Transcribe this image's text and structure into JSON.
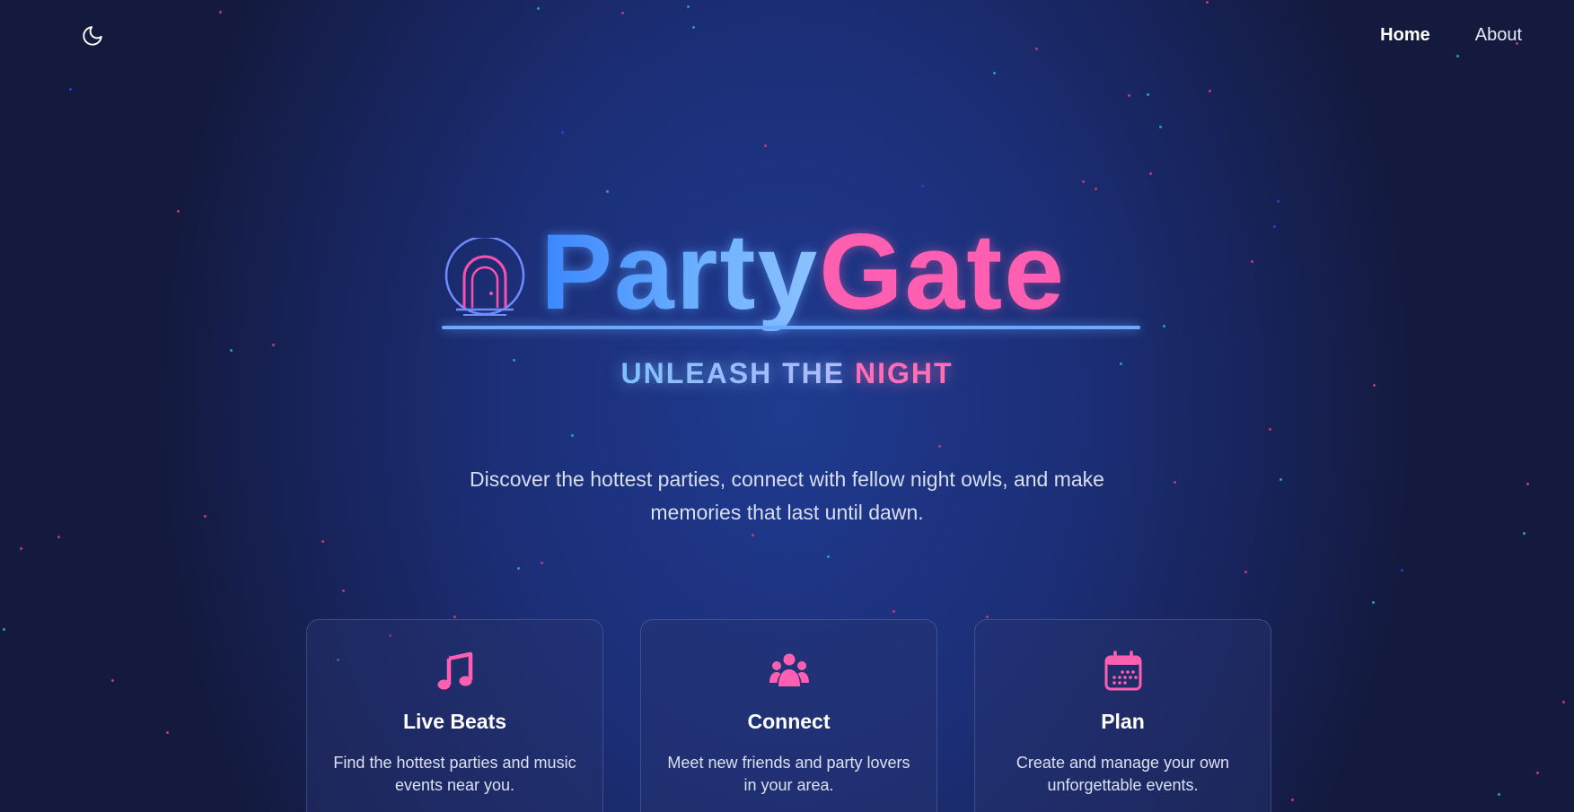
{
  "nav": {
    "home_label": "Home",
    "about_label": "About"
  },
  "theme_toggle": {
    "icon": "moon-icon"
  },
  "logo": {
    "icon": "door-arch-icon",
    "part_text": "Party",
    "gate_text": "Gate"
  },
  "tagline": {
    "part1": "UNLEASH THE ",
    "part2": "NIGHT"
  },
  "description": {
    "line1": "Discover the hottest parties, connect with fellow night owls, and make",
    "line2": "memories that last until dawn."
  },
  "features": [
    {
      "icon": "music-note-icon",
      "title": "Live Beats",
      "description": "Find the hottest parties and music events near you."
    },
    {
      "icon": "users-icon",
      "title": "Connect",
      "description": "Meet new friends and party lovers in your area."
    },
    {
      "icon": "calendar-icon",
      "title": "Plan",
      "description": "Create and manage your own unforgettable events."
    }
  ],
  "colors": {
    "background": "#1c2f78",
    "blue_accent": "#63a8ff",
    "pink_accent": "#ff5fb0"
  }
}
